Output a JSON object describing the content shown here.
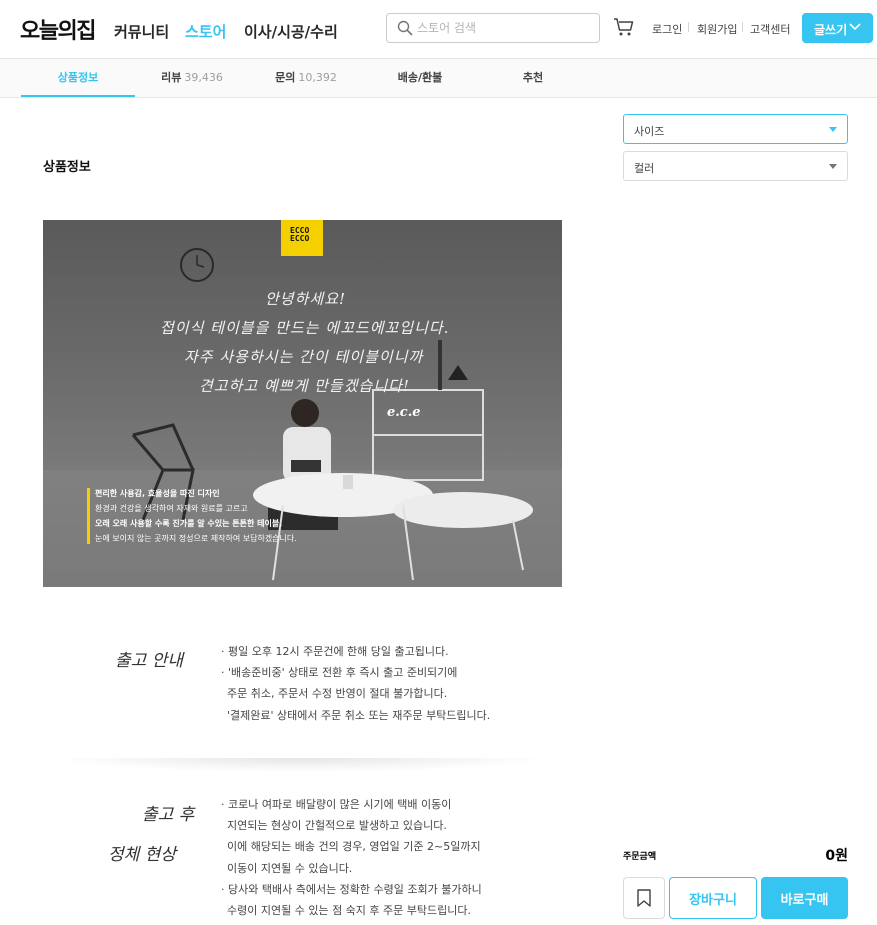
{
  "header": {
    "logo": "오늘의집",
    "nav": [
      "커뮤니티",
      "스토어",
      "이사/시공/수리"
    ],
    "active_nav": "스토어",
    "search_placeholder": "스토어 검색",
    "links": [
      "로그인",
      "회원가입",
      "고객센터"
    ],
    "write_label": "글쓰기"
  },
  "tabs": [
    {
      "label": "상품정보",
      "count": ""
    },
    {
      "label": "리뷰",
      "count": "39,436"
    },
    {
      "label": "문의",
      "count": "10,392"
    },
    {
      "label": "배송/환불",
      "count": ""
    },
    {
      "label": "추천",
      "count": ""
    }
  ],
  "section_title": "상품정보",
  "options": {
    "size_label": "사이즈",
    "color_label": "컬러"
  },
  "product_image": {
    "brand_mark": "ECCO\nECCO",
    "handwritten_lines": [
      "안녕하세요!",
      "접이식 테이블을 만드는 에꼬드에꼬입니다.",
      "자주 사용하시는 간이 테이블이니까",
      "견고하고 예쁘게 만들겠습니다!"
    ],
    "signature": "e.c.e",
    "caption_lines": [
      "편리한 사용감, 효율성을 따진 디자인",
      "환경과 건강을 생각하여 자재와 원료를 고르고",
      "오래 오래 사용할 수록 진가를 알 수있는 튼튼한 테이블.",
      "눈에 보이지 않는 곳까지 정성으로 제작하여 보답하겠습니다."
    ]
  },
  "shipping": {
    "title": "출고 안내",
    "lines": [
      "· 평일 오후 12시 주문건에 한해 당일 출고됩니다.",
      "· '배송준비중' 상태로 전환 후 즉시 출고 준비되기에",
      "주문 취소, 주문서 수정 반영이 절대 불가합니다.",
      "'결제완료' 상태에서 주문 취소 또는 재주문 부탁드립니다."
    ]
  },
  "delay": {
    "title_line1": "출고 후",
    "title_line2": "정체 현상",
    "lines": [
      "· 코로나 여파로 배달량이 많은 시기에 택배 이동이",
      "지연되는 현상이 간헐적으로 발생하고 있습니다.",
      "이에 해당되는 배송 건의 경우, 영업일 기준 2~5일까지",
      "이동이 지연될 수 있습니다.",
      "· 당사와 택배사 측에서는 정확한 수령일 조회가 불가하니",
      "수령이 지연될 수 있는 점 숙지 후 주문 부탁드립니다."
    ]
  },
  "order": {
    "price_label": "주문금액",
    "price_value": "0원",
    "cart_label": "장바구니",
    "buy_label": "바로구매"
  },
  "colors": {
    "accent": "#35c5f0",
    "brand_yellow": "#f4d000"
  }
}
